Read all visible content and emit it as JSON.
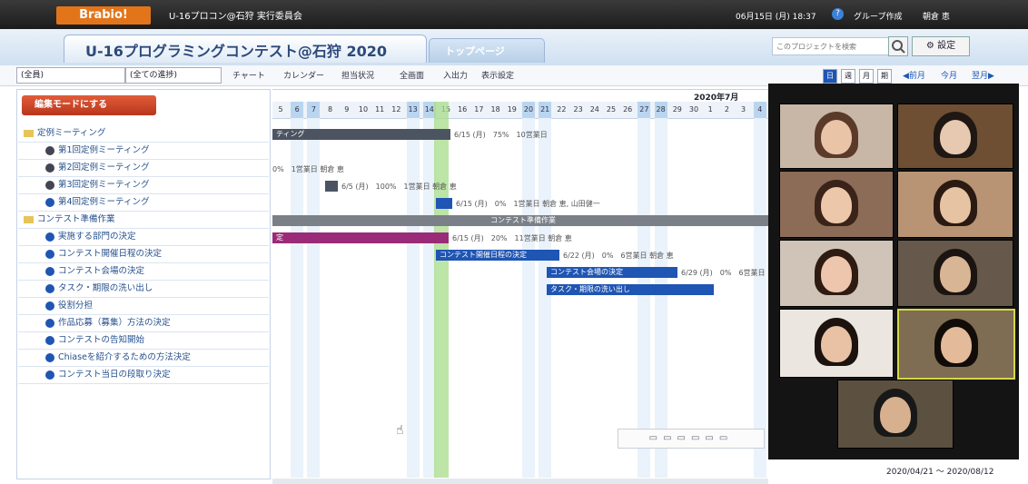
{
  "app": {
    "logo": "Brabio!",
    "project_crumb": "U-16プロコン@石狩 実行委員会",
    "datetime": "06月15日 (月) 18:37",
    "group_create": "グループ作成",
    "user": "朝倉 恵"
  },
  "header": {
    "project_tab": "U-16プログラミングコンテスト@石狩 2020",
    "top_tab": "トップページ",
    "search_placeholder": "このプロジェクトを検索",
    "settings": "設定"
  },
  "toolbar": {
    "filter1": "(全員)",
    "filter2": "(全ての進捗)",
    "chart": "チャート",
    "calendar": "カレンダー",
    "assignee": "担当状況",
    "fullscreen": "全画面",
    "io": "入出力",
    "display": "表示設定",
    "view_day": "日",
    "view_week": "週",
    "view_month": "月",
    "view_period": "期",
    "prev_month": "◀前月",
    "this_month": "今月",
    "next_month": "翌月▶"
  },
  "tree": {
    "edit_button": "編集モードにする",
    "rows": [
      {
        "type": "folder",
        "label": "定例ミーティング"
      },
      {
        "type": "done",
        "label": "第1回定例ミーティング"
      },
      {
        "type": "done",
        "label": "第2回定例ミーティング"
      },
      {
        "type": "done",
        "label": "第3回定例ミーティング"
      },
      {
        "type": "task",
        "label": "第4回定例ミーティング"
      },
      {
        "type": "folder",
        "label": "コンテスト準備作業"
      },
      {
        "type": "task",
        "label": "実施する部門の決定"
      },
      {
        "type": "task",
        "label": "コンテスト開催日程の決定"
      },
      {
        "type": "task",
        "label": "コンテスト会場の決定"
      },
      {
        "type": "task",
        "label": "タスク・期限の洗い出し"
      },
      {
        "type": "task",
        "label": "役割分担"
      },
      {
        "type": "task",
        "label": "作品応募（募集）方法の決定"
      },
      {
        "type": "task",
        "label": "コンテストの告知開始"
      },
      {
        "type": "task",
        "label": "Chiaseを紹介するための方法決定"
      },
      {
        "type": "task",
        "label": "コンテスト当日の段取り決定"
      }
    ]
  },
  "gantt": {
    "month": "2020年7月",
    "days": [
      "5",
      "6",
      "7",
      "8",
      "9",
      "10",
      "11",
      "12",
      "13",
      "14",
      "15",
      "16",
      "17",
      "18",
      "19",
      "20",
      "21",
      "22",
      "23",
      "24",
      "25",
      "26",
      "27",
      "28",
      "29",
      "30",
      "1",
      "2",
      "3",
      "4"
    ],
    "bars": [
      {
        "label": "ティング",
        "info": "6/15 (月)　75%　10営業日",
        "color": "#4c5462"
      },
      {
        "label": "",
        "info": "0%　1営業日 朝倉 恵",
        "color": ""
      },
      {
        "label": "",
        "info": "6/5 (月)　100%　1営業日 朝倉 恵",
        "color": "#4c5462"
      },
      {
        "label": "",
        "info": "6/15 (月)　0%　1営業日 朝倉 恵, 山田健一",
        "color": "#1f55b3"
      },
      {
        "label": "コンテスト準備作業",
        "info": "",
        "color": "#7a7f88"
      },
      {
        "label": "定",
        "info": "6/15 (月)　20%　11営業日 朝倉 恵",
        "color": "#9a2b78"
      },
      {
        "label": "コンテスト開催日程の決定",
        "info": "6/22 (月)　0%　6営業日 朝倉 恵",
        "color": "#1f55b3"
      },
      {
        "label": "コンテスト会場の決定",
        "info": "6/29 (月)　0%　6営業日",
        "color": "#1f55b3"
      },
      {
        "label": "タスク・期限の洗い出し",
        "info": "",
        "color": "#1f55b3"
      }
    ]
  },
  "date_range": "2020/04/21 ～ 2020/08/12",
  "colors": {
    "accent": "#e2751a",
    "bar": "#1f55b3",
    "today": "#a7dc8a"
  }
}
